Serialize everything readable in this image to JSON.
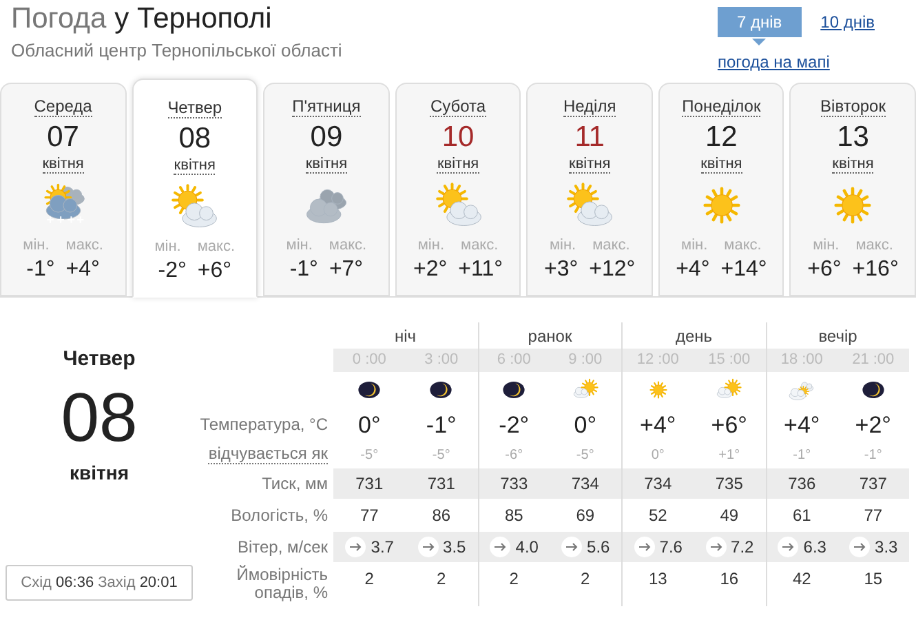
{
  "header": {
    "title_prefix": "Погода",
    "title_city": "у Тернополі",
    "subtitle": "Обласний центр Тернопільської області"
  },
  "tabs": [
    {
      "label": "7 днів",
      "selected": true
    },
    {
      "label": "10 днів",
      "selected": false
    }
  ],
  "map_link": "погода на мапі",
  "days": [
    {
      "weekday": "Середа",
      "date": "07",
      "month": "квітня",
      "kind": "snow_sun",
      "min_label": "мін.",
      "max_label": "макс.",
      "min": "-1°",
      "max": "+4°",
      "selected": false,
      "weekend": false
    },
    {
      "weekday": "Четвер",
      "date": "08",
      "month": "квітня",
      "kind": "cloud_sun",
      "min_label": "мін.",
      "max_label": "макс.",
      "min": "-2°",
      "max": "+6°",
      "selected": true,
      "weekend": false
    },
    {
      "weekday": "П'ятниця",
      "date": "09",
      "month": "квітня",
      "kind": "cloudy",
      "min_label": "мін.",
      "max_label": "макс.",
      "min": "-1°",
      "max": "+7°",
      "selected": false,
      "weekend": false
    },
    {
      "weekday": "Субота",
      "date": "10",
      "month": "квітня",
      "kind": "cloud_sun",
      "min_label": "мін.",
      "max_label": "макс.",
      "min": "+2°",
      "max": "+11°",
      "selected": false,
      "weekend": true
    },
    {
      "weekday": "Неділя",
      "date": "11",
      "month": "квітня",
      "kind": "cloud_sun",
      "min_label": "мін.",
      "max_label": "макс.",
      "min": "+3°",
      "max": "+12°",
      "selected": false,
      "weekend": true
    },
    {
      "weekday": "Понеділок",
      "date": "12",
      "month": "квітня",
      "kind": "sun",
      "min_label": "мін.",
      "max_label": "макс.",
      "min": "+4°",
      "max": "+14°",
      "selected": false,
      "weekend": false
    },
    {
      "weekday": "Вівторок",
      "date": "13",
      "month": "квітня",
      "kind": "sun",
      "min_label": "мін.",
      "max_label": "макс.",
      "min": "+6°",
      "max": "+16°",
      "selected": false,
      "weekend": false
    }
  ],
  "detail": {
    "weekday": "Четвер",
    "date": "08",
    "month": "квітня",
    "sunrise_label": "Схід",
    "sunrise": "06:36",
    "sunset_label": "Захід",
    "sunset": "20:01",
    "row_labels": [
      "Температура, °C",
      "відчувається як",
      "Тиск, мм",
      "Вологість, %",
      "Вітер, м/сек",
      "Ймовірність опадів, %"
    ],
    "periods": [
      {
        "label": "ніч",
        "hours": [
          {
            "time": "0 :00",
            "kind": "moon",
            "temp": "0°",
            "feels": "-5°",
            "pressure": "731",
            "humidity": "77",
            "wind": "3.7",
            "precip": "2"
          },
          {
            "time": "3 :00",
            "kind": "moon",
            "temp": "-1°",
            "feels": "-5°",
            "pressure": "731",
            "humidity": "86",
            "wind": "3.5",
            "precip": "2"
          }
        ]
      },
      {
        "label": "ранок",
        "hours": [
          {
            "time": "6 :00",
            "kind": "moon",
            "temp": "-2°",
            "feels": "-6°",
            "pressure": "733",
            "humidity": "85",
            "wind": "4.0",
            "precip": "2"
          },
          {
            "time": "9 :00",
            "kind": "cloud_sun_small",
            "temp": "0°",
            "feels": "-5°",
            "pressure": "734",
            "humidity": "69",
            "wind": "5.6",
            "precip": "2"
          }
        ]
      },
      {
        "label": "день",
        "hours": [
          {
            "time": "12 :00",
            "kind": "sun_small",
            "temp": "+4°",
            "feels": "0°",
            "pressure": "734",
            "humidity": "52",
            "wind": "7.6",
            "precip": "13"
          },
          {
            "time": "15 :00",
            "kind": "cloud_sun_small",
            "temp": "+6°",
            "feels": "+1°",
            "pressure": "735",
            "humidity": "49",
            "wind": "7.2",
            "precip": "16"
          }
        ]
      },
      {
        "label": "вечір",
        "hours": [
          {
            "time": "18 :00",
            "kind": "clouds_sun",
            "temp": "+4°",
            "feels": "-1°",
            "pressure": "736",
            "humidity": "61",
            "wind": "6.3",
            "precip": "42"
          },
          {
            "time": "21 :00",
            "kind": "moon",
            "temp": "+2°",
            "feels": "-1°",
            "pressure": "737",
            "humidity": "77",
            "wind": "3.3",
            "precip": "15"
          }
        ]
      }
    ]
  }
}
